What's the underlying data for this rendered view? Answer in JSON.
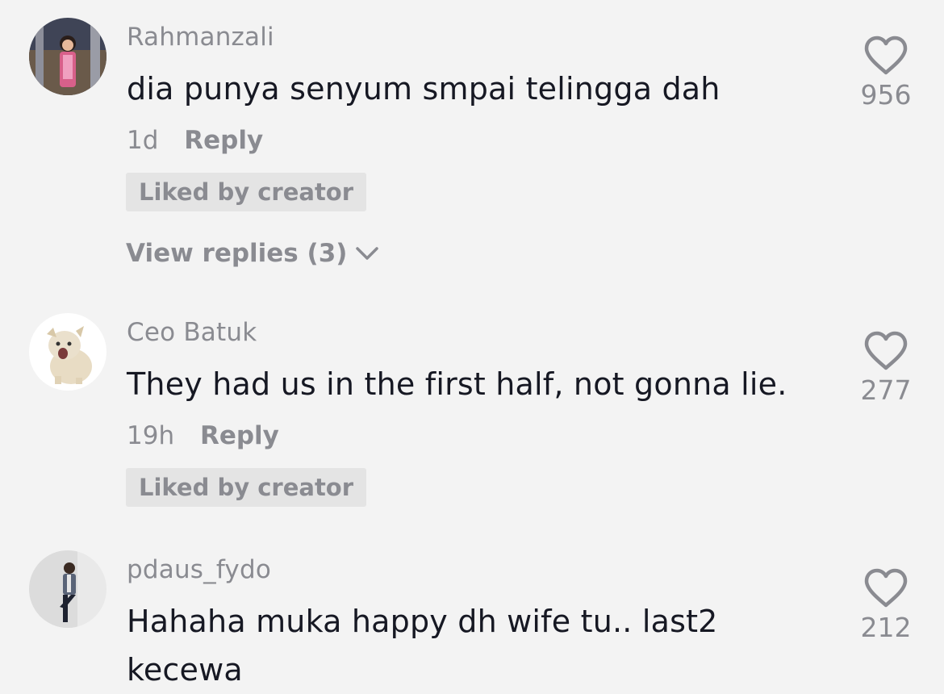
{
  "comments": [
    {
      "username": "Rahmanzali",
      "text": "dia punya senyum smpai telingga dah",
      "time": "1d",
      "reply_label": "Reply",
      "badge": "Liked by creator",
      "view_replies": "View replies (3)",
      "likes": "956"
    },
    {
      "username": "Ceo Batuk",
      "text": "They had us in the first half, not gonna lie.",
      "time": "19h",
      "reply_label": "Reply",
      "badge": "Liked by creator",
      "likes": "277"
    },
    {
      "username": "pdaus_fydo",
      "text": "Hahaha muka happy dh wife tu.. last2 kecewa",
      "likes": "212"
    }
  ],
  "icons": {
    "like": "heart-outline-icon",
    "expand": "chevron-down-icon"
  },
  "colors": {
    "background": "#f3f3f3",
    "primary_text": "#161823",
    "secondary_text": "#8a8b91",
    "badge_bg": "#e4e4e4"
  }
}
